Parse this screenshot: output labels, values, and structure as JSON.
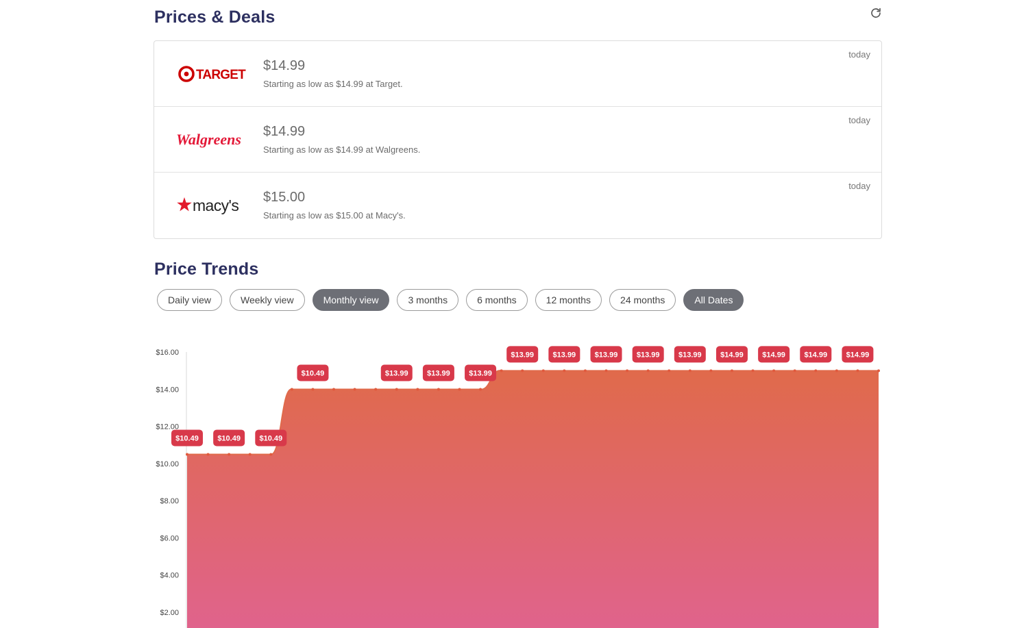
{
  "deals": {
    "title": "Prices & Deals",
    "refresh_icon": "refresh-icon",
    "items": [
      {
        "store": "Target",
        "logo_text": "TARGET",
        "price": "$14.99",
        "description": "Starting as low as $14.99 at Target.",
        "time": "today",
        "brand_color": "#cc0000"
      },
      {
        "store": "Walgreens",
        "logo_text": "Walgreens",
        "price": "$14.99",
        "description": "Starting as low as $14.99 at Walgreens.",
        "time": "today",
        "brand_color": "#e31837"
      },
      {
        "store": "Macy's",
        "logo_text": "macy's",
        "price": "$15.00",
        "description": "Starting as low as $15.00 at Macy's.",
        "time": "today",
        "brand_color": "#e21a2c"
      }
    ]
  },
  "trends": {
    "title": "Price Trends",
    "filters": [
      {
        "label": "Daily view",
        "active": false
      },
      {
        "label": "Weekly view",
        "active": false
      },
      {
        "label": "Monthly view",
        "active": true
      },
      {
        "label": "3 months",
        "active": false
      },
      {
        "label": "6 months",
        "active": false
      },
      {
        "label": "12 months",
        "active": false
      },
      {
        "label": "24 months",
        "active": false
      },
      {
        "label": "All Dates",
        "active": true
      }
    ]
  },
  "chart_data": {
    "type": "area",
    "title": "",
    "xlabel": "",
    "ylabel": "",
    "y_tick_labels": [
      "$2.00",
      "$4.00",
      "$6.00",
      "$8.00",
      "$10.00",
      "$12.00",
      "$14.00",
      "$16.00"
    ],
    "y_ticks": [
      2,
      4,
      6,
      8,
      10,
      12,
      14,
      16
    ],
    "ylim": [
      0,
      16
    ],
    "grid": false,
    "series": [
      {
        "values": [
          10.49,
          10.49,
          10.49,
          10.49,
          10.49,
          13.99,
          13.99,
          13.99,
          13.99,
          13.99,
          13.99,
          13.99,
          13.99,
          13.99,
          13.99,
          14.99,
          14.99,
          14.99,
          14.99,
          14.99,
          14.99,
          14.99,
          14.99,
          14.99,
          14.99,
          14.99,
          14.99,
          14.99,
          14.99,
          14.99,
          14.99,
          14.99,
          14.99,
          14.99
        ],
        "labels": [
          "$10.49",
          "$10.49",
          "$10.49",
          "$10.49",
          "$13.99",
          "$13.99",
          "$13.99",
          "$13.99",
          "$13.99",
          "$13.99",
          "$13.99",
          "$13.99",
          "$14.99",
          "$14.99",
          "$14.99",
          "$14.99"
        ],
        "label_indices": [
          0,
          2,
          4,
          6,
          10,
          12,
          14,
          16,
          18,
          20,
          22,
          24,
          26,
          28,
          30,
          32
        ]
      }
    ],
    "colors": {
      "top": "#e06a4b",
      "bottom": "#e0638c",
      "label_bg": "#d8394a",
      "point": "#e05a3e"
    }
  }
}
